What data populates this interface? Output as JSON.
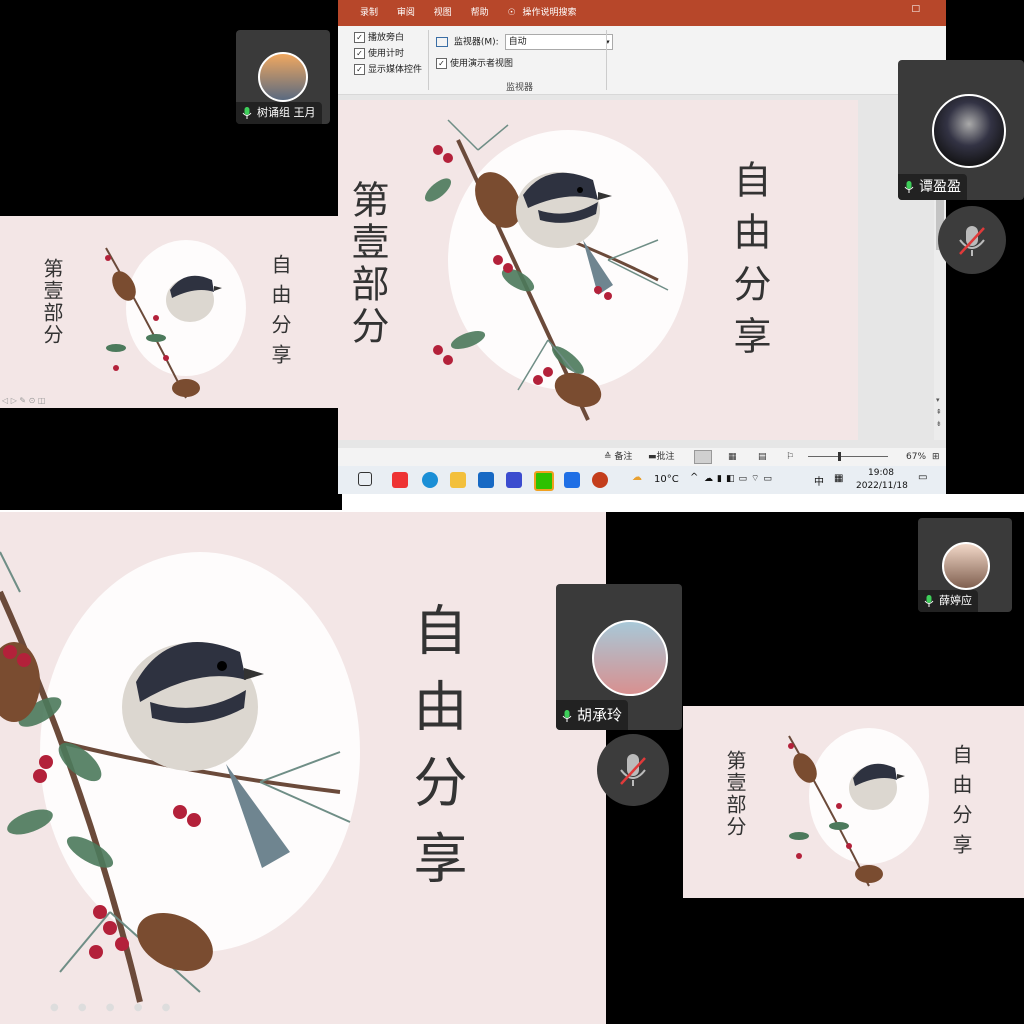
{
  "slide": {
    "left_title": "第壹部分",
    "right_title": "自由分享"
  },
  "ribbon": {
    "tabs": [
      "录制",
      "审阅",
      "视图",
      "帮助"
    ],
    "search_label": "操作说明搜索",
    "checkboxes": [
      "播放旁白",
      "使用计时",
      "显示媒体控件"
    ],
    "monitor_label": "监视器(M):",
    "monitor_value": "自动",
    "presenter_view_label": "使用演示者视图",
    "group_label": "监视器"
  },
  "status": {
    "notes_label": "备注",
    "comments_label": "批注",
    "zoom": "67%"
  },
  "taskbar": {
    "weather": "10°C",
    "ime": "中",
    "time": "19:08",
    "date": "2022/11/18"
  },
  "participants": [
    {
      "name": "树诵组  王月"
    },
    {
      "name": "谭盈盈"
    },
    {
      "name": "胡承玲"
    },
    {
      "name": "薛婷应"
    }
  ],
  "colors": {
    "ppt_accent": "#b7472a",
    "slide_bg": "#f3e6e6",
    "mic_green": "#3ecf5a",
    "mute_red": "#e03a3a"
  }
}
